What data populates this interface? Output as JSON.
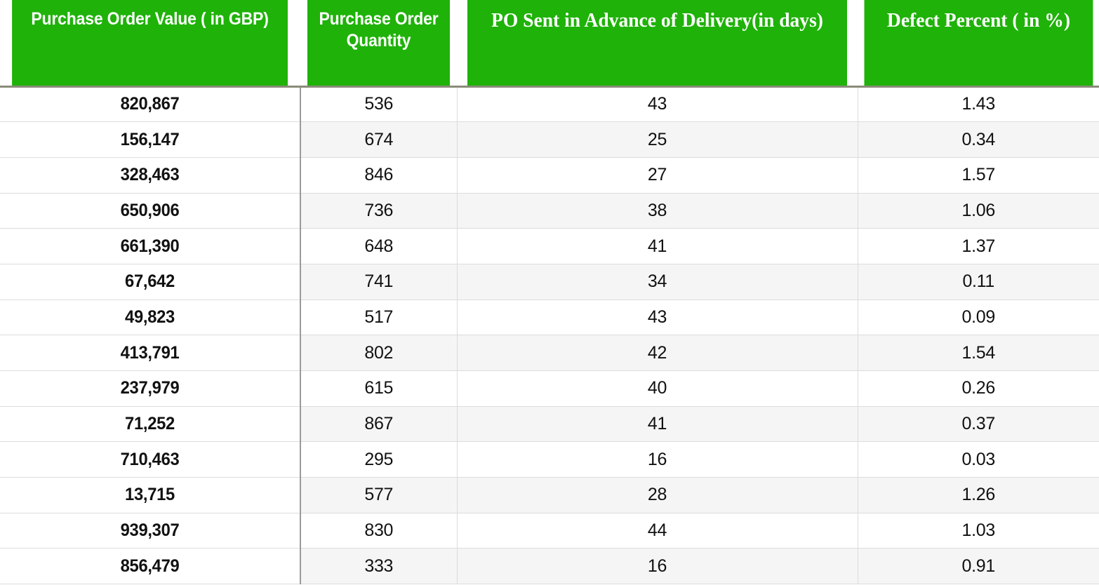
{
  "table": {
    "columns": [
      {
        "label": "Purchase Order Value ( in GBP)",
        "style": "sans-bold",
        "align": "center"
      },
      {
        "label": "Purchase Order Quantity",
        "style": "sans-bold",
        "align": "center"
      },
      {
        "label": "PO Sent in Advance of Delivery(in days)",
        "style": "serif-bold",
        "align": "center"
      },
      {
        "label": "Defect Percent ( in %)",
        "style": "serif-bold",
        "align": "center"
      }
    ],
    "header_background": "#1fb209",
    "header_text_color": "#ffffff",
    "stripe_color": "#f5f5f5",
    "rows": [
      {
        "po_value": "820,867",
        "po_quantity": "536",
        "po_advance_days": "43",
        "defect_percent": "1.43"
      },
      {
        "po_value": "156,147",
        "po_quantity": "674",
        "po_advance_days": "25",
        "defect_percent": "0.34"
      },
      {
        "po_value": "328,463",
        "po_quantity": "846",
        "po_advance_days": "27",
        "defect_percent": "1.57"
      },
      {
        "po_value": "650,906",
        "po_quantity": "736",
        "po_advance_days": "38",
        "defect_percent": "1.06"
      },
      {
        "po_value": "661,390",
        "po_quantity": "648",
        "po_advance_days": "41",
        "defect_percent": "1.37"
      },
      {
        "po_value": "67,642",
        "po_quantity": "741",
        "po_advance_days": "34",
        "defect_percent": "0.11"
      },
      {
        "po_value": "49,823",
        "po_quantity": "517",
        "po_advance_days": "43",
        "defect_percent": "0.09"
      },
      {
        "po_value": "413,791",
        "po_quantity": "802",
        "po_advance_days": "42",
        "defect_percent": "1.54"
      },
      {
        "po_value": "237,979",
        "po_quantity": "615",
        "po_advance_days": "40",
        "defect_percent": "0.26"
      },
      {
        "po_value": "71,252",
        "po_quantity": "867",
        "po_advance_days": "41",
        "defect_percent": "0.37"
      },
      {
        "po_value": "710,463",
        "po_quantity": "295",
        "po_advance_days": "16",
        "defect_percent": "0.03"
      },
      {
        "po_value": "13,715",
        "po_quantity": "577",
        "po_advance_days": "28",
        "defect_percent": "1.26"
      },
      {
        "po_value": "939,307",
        "po_quantity": "830",
        "po_advance_days": "44",
        "defect_percent": "1.03"
      },
      {
        "po_value": "856,479",
        "po_quantity": "333",
        "po_advance_days": "16",
        "defect_percent": "0.91"
      }
    ]
  }
}
